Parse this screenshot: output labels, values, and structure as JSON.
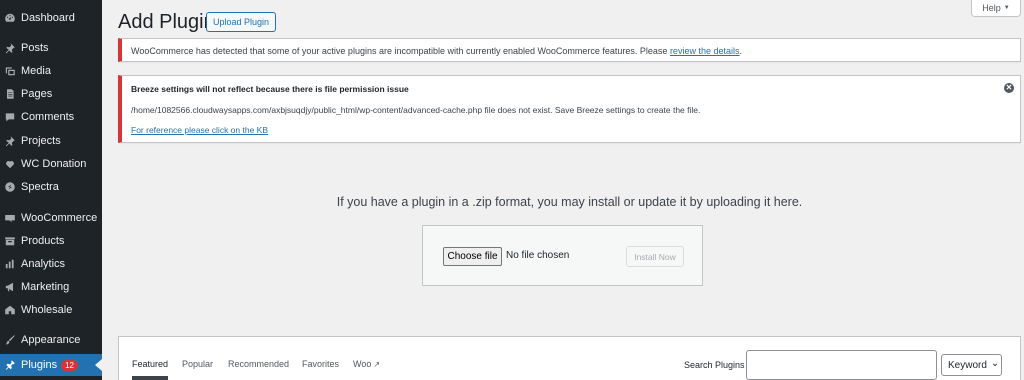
{
  "sidebar": {
    "items": [
      {
        "label": "Dashboard",
        "icon": "dashboard-icon"
      },
      {
        "label": "Posts",
        "icon": "pin-icon"
      },
      {
        "label": "Media",
        "icon": "media-icon"
      },
      {
        "label": "Pages",
        "icon": "pages-icon"
      },
      {
        "label": "Comments",
        "icon": "comments-icon"
      },
      {
        "label": "Projects",
        "icon": "pin-icon"
      },
      {
        "label": "WC Donation",
        "icon": "heart-icon"
      },
      {
        "label": "Spectra",
        "icon": "spectra-icon"
      },
      {
        "label": "WooCommerce",
        "icon": "woo-icon"
      },
      {
        "label": "Products",
        "icon": "archive-icon"
      },
      {
        "label": "Analytics",
        "icon": "chart-icon"
      },
      {
        "label": "Marketing",
        "icon": "megaphone-icon"
      },
      {
        "label": "Wholesale",
        "icon": "wholesale-icon"
      },
      {
        "label": "Appearance",
        "icon": "brush-icon"
      },
      {
        "label": "Plugins",
        "icon": "plugin-icon",
        "badge": "12",
        "active": true
      }
    ]
  },
  "header": {
    "title": "Add Plugins",
    "upload_button": "Upload Plugin",
    "help_tab": "Help",
    "help_arrow": "▼"
  },
  "notices": {
    "woo": {
      "text": "WooCommerce has detected that some of your active plugins are incompatible with currently enabled WooCommerce features. Please ",
      "link": "review the details",
      "suffix": "."
    },
    "breeze": {
      "title": "Breeze settings will not reflect because there is file permission issue",
      "path_text": "/home/1082566.cloudwaysapps.com/axbjsuqdjy/public_html/wp-content/advanced-cache.php file does not exist. Save Breeze settings to create the file.",
      "link": "For reference please click on the KB",
      "dismiss": "✕"
    }
  },
  "upload": {
    "help_text": "If you have a plugin in a .zip format, you may install or update it by uploading it here.",
    "choose_file": "Choose file",
    "no_file": "No file chosen",
    "install_now": "Install Now"
  },
  "filter_bar": {
    "tabs": [
      "Featured",
      "Popular",
      "Recommended",
      "Favorites",
      "Woo"
    ],
    "current": "Featured",
    "external_glyph": "↗",
    "search_label": "Search Plugins",
    "search_value": "",
    "select_value": "Keyword",
    "select_arrow": "⌄"
  },
  "colors": {
    "sidebar_bg": "#1d2327",
    "accent": "#2271b1",
    "error": "#d63638",
    "page_bg": "#f0f0f1"
  }
}
